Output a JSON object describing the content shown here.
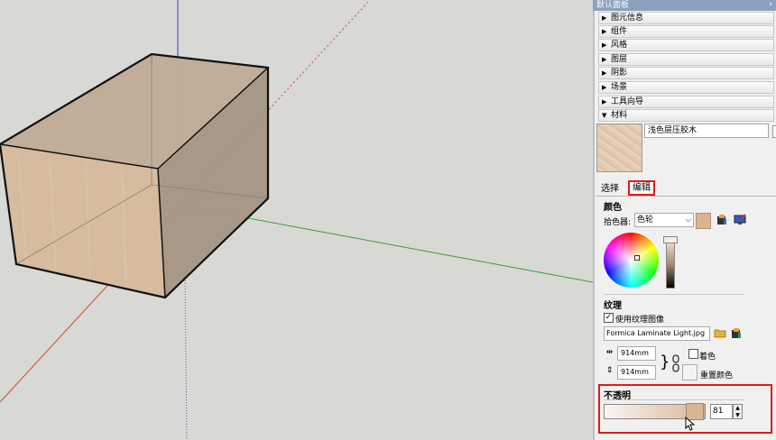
{
  "tray": {
    "title": "默认面板",
    "pin_glyph": "ᵖ",
    "panels": [
      {
        "label": "图元信息",
        "expanded": false
      },
      {
        "label": "组件",
        "expanded": false
      },
      {
        "label": "风格",
        "expanded": false
      },
      {
        "label": "图层",
        "expanded": false
      },
      {
        "label": "阴影",
        "expanded": false
      },
      {
        "label": "场景",
        "expanded": false
      },
      {
        "label": "工具向导",
        "expanded": false
      },
      {
        "label": "材料",
        "expanded": true
      }
    ],
    "collapsed_glyph": "▶",
    "expanded_glyph": "▼"
  },
  "material": {
    "name": "浅色层压胶木",
    "tabs": {
      "select": "选择",
      "edit": "编辑"
    },
    "color": {
      "section": "颜色",
      "picker_label": "拾色器:",
      "picker_value": "色轮",
      "swatch_hex": "#d9b596"
    },
    "texture": {
      "section": "纹理",
      "use_texture_label": "使用纹理图像",
      "use_texture_checked": true,
      "file": "Formica Laminate Light.jpg",
      "width": "914mm",
      "height": "914mm",
      "colorize_label": "着色",
      "reset_color_label": "重置颜色"
    },
    "opacity": {
      "section": "不透明",
      "value": "81"
    }
  },
  "colors": {
    "highlight": "#e01c1c",
    "axis_blue": "#3a3ad8",
    "axis_green": "#3c9a3c",
    "axis_red": "#d04a2a"
  }
}
